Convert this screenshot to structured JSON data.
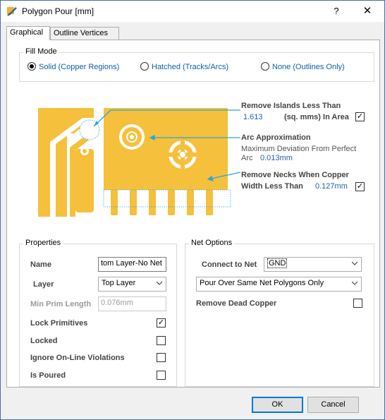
{
  "window": {
    "title": "Polygon Pour [mm]",
    "help_glyph": "?",
    "close_glyph": "✕"
  },
  "tabs": [
    {
      "label": "Graphical"
    },
    {
      "label": "Outline Vertices"
    }
  ],
  "fill_mode": {
    "label": "Fill Mode",
    "options": [
      {
        "label": "Solid (Copper Regions)",
        "selected": true
      },
      {
        "label": "Hatched (Tracks/Arcs)",
        "selected": false
      },
      {
        "label": "None (Outlines Only)",
        "selected": false
      }
    ]
  },
  "illustration": {
    "remove_islands": {
      "label": "Remove Islands Less Than",
      "value": "1.613",
      "unit": "(sq. mms) In Area",
      "checked": true
    },
    "arc_approx": {
      "label": "Arc Approximation",
      "line1": "Maximum Deviation From Perfect",
      "line2": "Arc",
      "value": "0.013mm"
    },
    "remove_necks": {
      "label": "Remove Necks When Copper",
      "line2": "Width Less Than",
      "value": "0.127mm",
      "checked": true
    },
    "copper_color": "#f5c03c",
    "accent_color": "#29a8d8"
  },
  "properties": {
    "label": "Properties",
    "name_label": "Name",
    "name_value": "tom Layer-No Net",
    "layer_label": "Layer",
    "layer_value": "Top Layer",
    "min_prim_label": "Min Prim Length",
    "min_prim_value": "0.076mm",
    "lock_primitives_label": "Lock Primitives",
    "lock_primitives_checked": true,
    "locked_label": "Locked",
    "locked_checked": false,
    "ignore_online_label": "Ignore On-Line Violations",
    "ignore_online_checked": false,
    "is_poured_label": "Is Poured",
    "is_poured_checked": false
  },
  "net_options": {
    "label": "Net Options",
    "connect_label": "Connect to Net",
    "connect_value": "GND",
    "pour_mode_value": "Pour Over Same Net Polygons Only",
    "remove_dead_label": "Remove Dead Copper",
    "remove_dead_checked": false
  },
  "buttons": {
    "ok": "OK",
    "cancel": "Cancel"
  }
}
